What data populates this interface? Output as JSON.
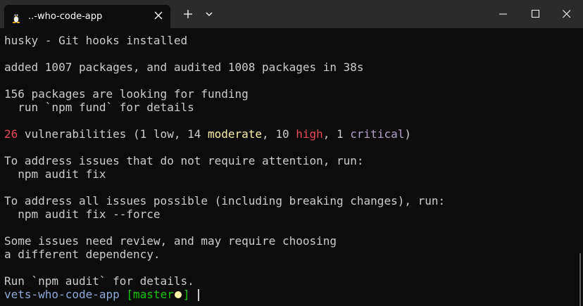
{
  "window": {
    "tab_title": "..-who-code-app",
    "tab_icon": "linux-penguin-icon",
    "buttons": [
      "new-tab",
      "dropdown",
      "minimize",
      "maximize",
      "close"
    ]
  },
  "terminal": {
    "lines": {
      "l1": "husky - Git hooks installed",
      "l2": "added 1007 packages, and audited 1008 packages in 38s",
      "l3": "156 packages are looking for funding",
      "l4": "  run `npm fund` for details",
      "l6": "To address issues that do not require attention, run:",
      "l7": "  npm audit fix",
      "l8": "To address all issues possible (including breaking changes), run:",
      "l9": "  npm audit fix --force",
      "l10": "Some issues need review, and may require choosing",
      "l11": "a different dependency.",
      "l12": "Run `npm audit` for details."
    },
    "vuln": {
      "count": "26",
      "text1": " vulnerabilities (1 low, 14 ",
      "moderate": "moderate",
      "text2": ", 10 ",
      "high": "high",
      "text3": ", 1 ",
      "critical": "critical",
      "text4": ")"
    },
    "prompt": {
      "dir": "vets-who-code-app",
      "branch_open": " [master",
      "branch_close": "]"
    }
  },
  "colors": {
    "background": "#0c0c0c",
    "text": "#cccccc",
    "red": "#e74856",
    "yellow": "#f9f1a5",
    "magenta": "#b4a0c8",
    "cyan": "#8fa8d8"
  }
}
